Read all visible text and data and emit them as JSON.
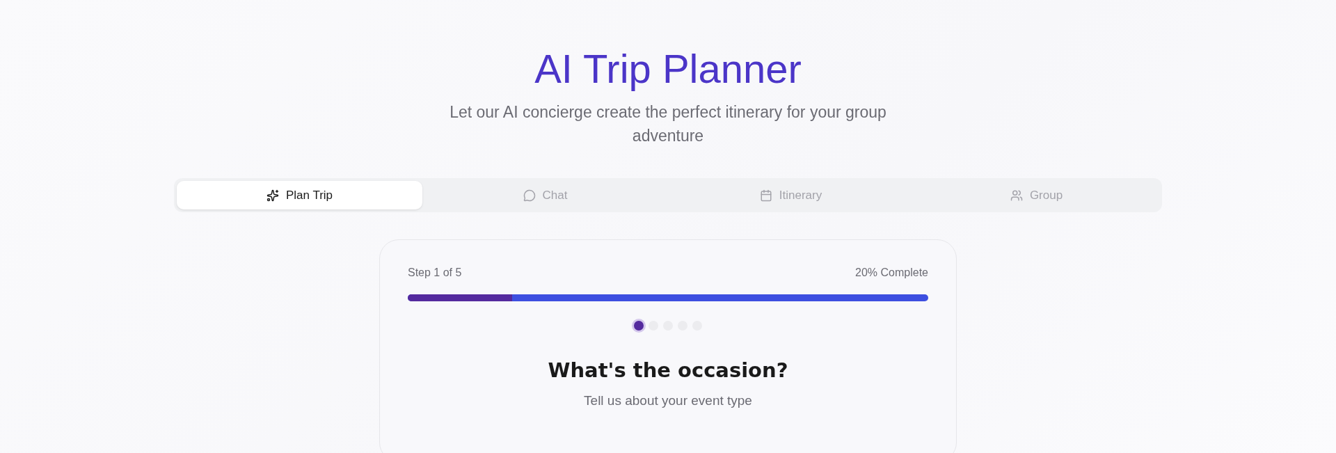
{
  "header": {
    "title": "AI Trip Planner",
    "subtitle": "Let our AI concierge create the perfect itinerary for your group adventure"
  },
  "tabs": [
    {
      "label": "Plan Trip",
      "kind": "sparkles",
      "selected": true
    },
    {
      "label": "Chat",
      "kind": "chat",
      "selected": false
    },
    {
      "label": "Itinerary",
      "kind": "calendar",
      "selected": false
    },
    {
      "label": "Group",
      "kind": "users",
      "selected": false
    }
  ],
  "wizard": {
    "step_label": "Step 1 of 5",
    "complete_label": "20% Complete",
    "progress": {
      "level": 0.2
    },
    "steps": [
      {
        "selected": true
      },
      {
        "selected": false
      },
      {
        "selected": false
      },
      {
        "selected": false
      },
      {
        "selected": false
      }
    ],
    "question": "What's the occasion?",
    "hint": "Tell us about your event type"
  }
}
